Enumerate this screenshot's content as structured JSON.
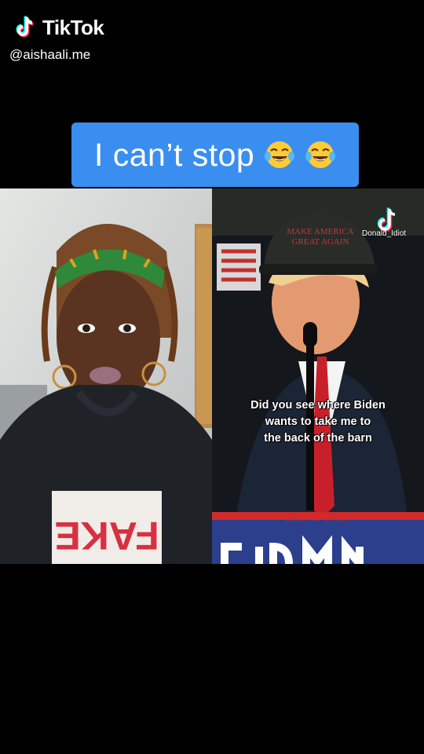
{
  "watermark": {
    "brand": "TikTok",
    "handle": "@aishaali.me",
    "logo_icon": "tiktok-logo-icon"
  },
  "caption": {
    "text": "I can’t stop",
    "emoji_icon": "tears-of-joy-emoji-icon",
    "emoji_count": 2,
    "bg_color": "#3a8ef0"
  },
  "left_video": {
    "shirt_text": "FAKE"
  },
  "right_video": {
    "hat_text": [
      "MAKE AMERICA",
      "GREAT AGAIN"
    ],
    "subtitle_lines": [
      "Did you see where Biden",
      "wants to take me to",
      "the back of the barn"
    ],
    "duet_watermark": "Donald_Idiot"
  }
}
